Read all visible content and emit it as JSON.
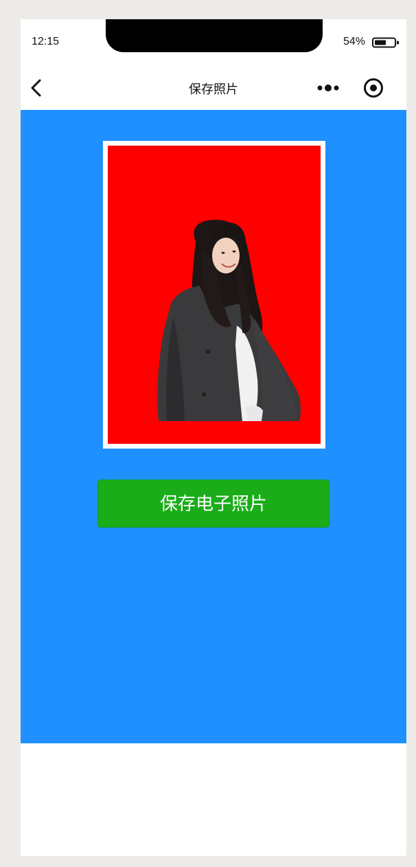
{
  "status_bar": {
    "time": "12:15",
    "battery_percent": "54%",
    "battery_level": 0.54
  },
  "nav": {
    "title": "保存照片",
    "back_icon": "chevron-left-icon",
    "more_icon": "more-dots-icon",
    "target_icon": "target-icon"
  },
  "photo": {
    "background_color": "#ff0000",
    "frame_color": "#ffffff"
  },
  "actions": {
    "save_label": "保存电子照片"
  },
  "colors": {
    "page_background": "#1e90ff",
    "button_green": "#1aad19"
  }
}
